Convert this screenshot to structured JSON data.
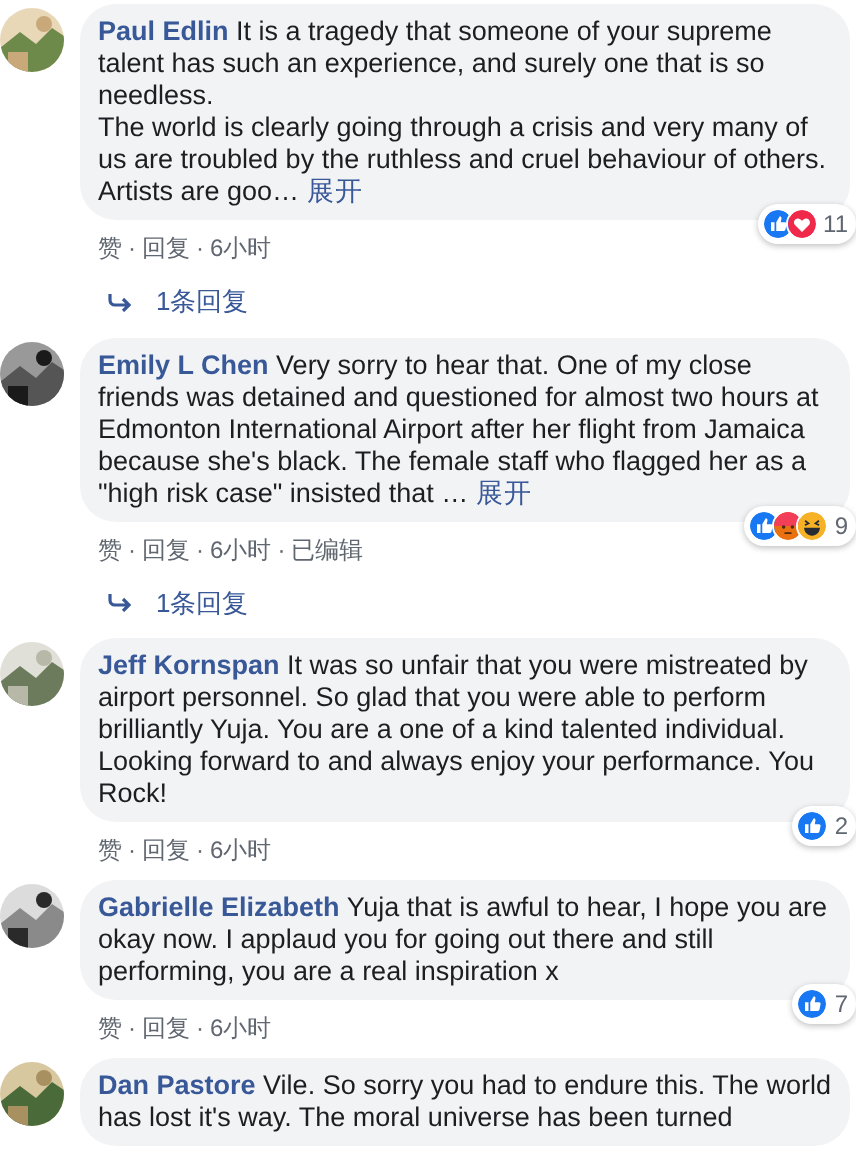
{
  "comments": [
    {
      "author": "Paul Edlin",
      "text": "It is a tragedy that someone of your supreme talent has such an experience, and surely one that is so needless.\nThe world is clearly going through a crisis and very many of us are troubled by the ruthless and cruel behaviour of others. Artists are goo…",
      "see_more": "展开",
      "actions": [
        {
          "kind": "link",
          "text": "赞"
        },
        {
          "kind": "separator",
          "text": "·"
        },
        {
          "kind": "link",
          "text": "回复"
        },
        {
          "kind": "separator",
          "text": "·"
        },
        {
          "kind": "link",
          "text": "6小时"
        }
      ],
      "reactions": {
        "icons": [
          {
            "kind": "like"
          },
          {
            "kind": "love"
          }
        ],
        "count": "11"
      },
      "replies": "1条回复"
    },
    {
      "author": "Emily L Chen",
      "text": "Very sorry to hear that. One of my close friends was detained and questioned for almost two hours at Edmonton International Airport after her flight from Jamaica because she's black. The female staff who flagged her as a \"high risk case\" insisted that …",
      "see_more": "展开",
      "actions": [
        {
          "kind": "link",
          "text": "赞"
        },
        {
          "kind": "separator",
          "text": "·"
        },
        {
          "kind": "link",
          "text": "回复"
        },
        {
          "kind": "separator",
          "text": "·"
        },
        {
          "kind": "link",
          "text": "6小时"
        },
        {
          "kind": "separator",
          "text": "·"
        },
        {
          "kind": "link",
          "text": "已编辑"
        }
      ],
      "reactions": {
        "icons": [
          {
            "kind": "like"
          },
          {
            "kind": "angry"
          },
          {
            "kind": "haha"
          }
        ],
        "count": "9"
      },
      "replies": "1条回复"
    },
    {
      "author": "Jeff Kornspan",
      "text": "It was so unfair that you were mistreated by airport personnel. So glad that you were able to perform brilliantly Yuja. You are a one of a kind talented individual. Looking forward to and always enjoy your performance. You Rock!",
      "actions": [
        {
          "kind": "link",
          "text": "赞"
        },
        {
          "kind": "separator",
          "text": "·"
        },
        {
          "kind": "link",
          "text": "回复"
        },
        {
          "kind": "separator",
          "text": "·"
        },
        {
          "kind": "link",
          "text": "6小时"
        }
      ],
      "reactions": {
        "icons": [
          {
            "kind": "like"
          }
        ],
        "count": "2"
      }
    },
    {
      "author": "Gabrielle Elizabeth",
      "text": "Yuja that is awful to hear, I hope you are okay now. I applaud you for going out there and still performing, you are a real inspiration x",
      "actions": [
        {
          "kind": "link",
          "text": "赞"
        },
        {
          "kind": "separator",
          "text": "·"
        },
        {
          "kind": "link",
          "text": "回复"
        },
        {
          "kind": "separator",
          "text": "·"
        },
        {
          "kind": "link",
          "text": "6小时"
        }
      ],
      "reactions": {
        "icons": [
          {
            "kind": "like"
          }
        ],
        "count": "7"
      }
    },
    {
      "author": "Dan Pastore",
      "text": "Vile. So sorry you had to endure this. The world has lost it's way. The moral universe has been turned"
    }
  ]
}
